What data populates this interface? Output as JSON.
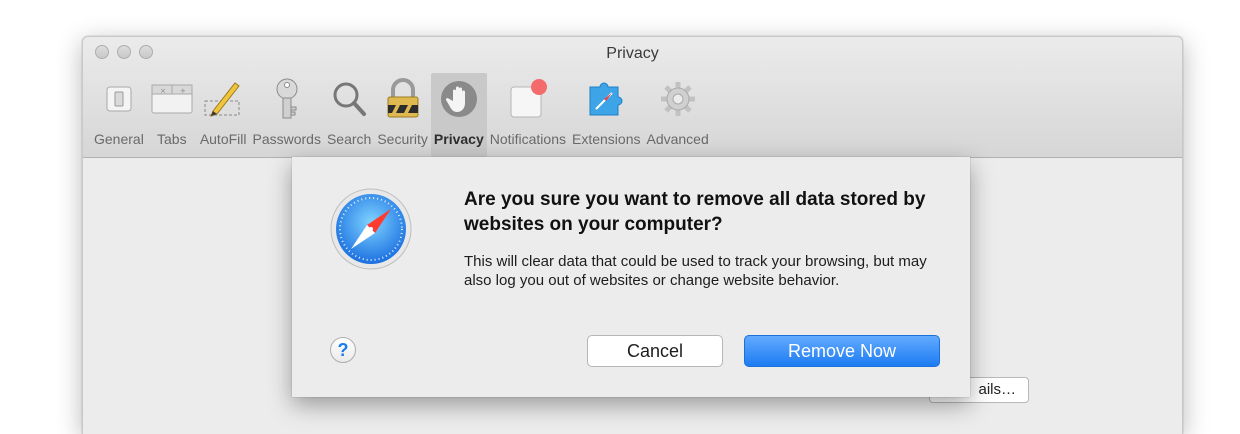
{
  "window": {
    "title": "Privacy"
  },
  "toolbar": {
    "items": [
      {
        "label": "General",
        "icon": "general-switch-icon"
      },
      {
        "label": "Tabs",
        "icon": "tabs-icon"
      },
      {
        "label": "AutoFill",
        "icon": "autofill-pencil-icon"
      },
      {
        "label": "Passwords",
        "icon": "key-icon"
      },
      {
        "label": "Search",
        "icon": "magnifier-icon"
      },
      {
        "label": "Security",
        "icon": "padlock-icon"
      },
      {
        "label": "Privacy",
        "icon": "hand-icon",
        "selected": true
      },
      {
        "label": "Notifications",
        "icon": "notification-badge-icon"
      },
      {
        "label": "Extensions",
        "icon": "puzzle-piece-icon"
      },
      {
        "label": "Advanced",
        "icon": "gear-icon"
      }
    ]
  },
  "background": {
    "details_button": "ails…"
  },
  "dialog": {
    "icon": "safari-compass-icon",
    "heading": "Are you sure you want to remove all data stored by websites on your computer?",
    "message": "This will clear data that could be used to track your browsing, but may also log you out of websites or change website behavior.",
    "help_label": "?",
    "cancel_label": "Cancel",
    "confirm_label": "Remove Now"
  },
  "colors": {
    "accent": "#1d7cf2",
    "notification_badge": "#f36b6b",
    "window_bg": "#ececec"
  }
}
